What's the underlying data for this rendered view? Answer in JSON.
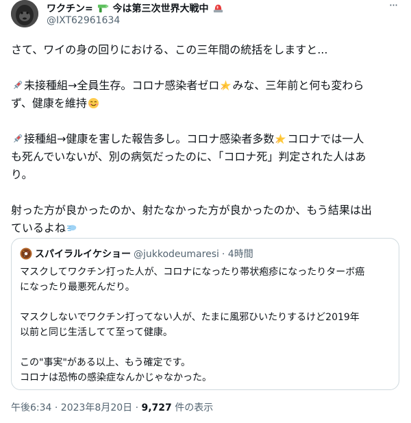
{
  "author": {
    "display_name": "ワクチン=",
    "display_name_tail": " 今は第三次世界大戦中",
    "handle": "@IXT62961634"
  },
  "tweet": {
    "line1": "さて、ワイの身の回りにおける、この三年間の統括をしますと...",
    "p2_a": "未接種組→全員生存。コロナ感染者ゼロ",
    "p2_b": "みな、三年前と何も変わら",
    "p2_c": "ず、健康を維持",
    "p3_a": "接種組→健康を害した報告多し。コロナ感染者多数",
    "p3_b": "コロナでは一人",
    "p3_c": "も死んでいないが、別の病気だったのに、「コロナ死」判定された人はあ",
    "p3_d": "り。",
    "p4_a": "射った方が良かったのか、射たなかった方が良かったのか、もう結果は出",
    "p4_b": "ているよね"
  },
  "quote": {
    "name": "スパイラルイケショー",
    "handle": "@jukkodeumaresi",
    "time": "· 4時間",
    "l1": "マスクしてワクチン打った人が、コロナになったり帯状疱疹になったりターボ癌",
    "l2": "になったり最悪死んだり。",
    "l3": "マスクしないでワクチン打ってない人が、たまに風邪ひいたりするけど2019年",
    "l4": "以前と同じ生活してて至って健康。",
    "l5": "この\"事実\"がある以上、もう確定です。",
    "l6": "コロナは恐怖の感染症なんかじゃなかった。"
  },
  "footer": {
    "time": "午後6:34 · 2023年8月20日 · ",
    "views_count": "9,727",
    "views_label": " 件の表示"
  },
  "icons": [
    "gun-emoji",
    "siren-emoji",
    "syringe-emoji",
    "dizzy-emoji",
    "smile-emoji",
    "dash-emoji",
    "donut-avatar",
    "more-icon"
  ],
  "colors": {
    "text": "#0f1419",
    "muted": "#536471",
    "border": "#cfd9de"
  }
}
